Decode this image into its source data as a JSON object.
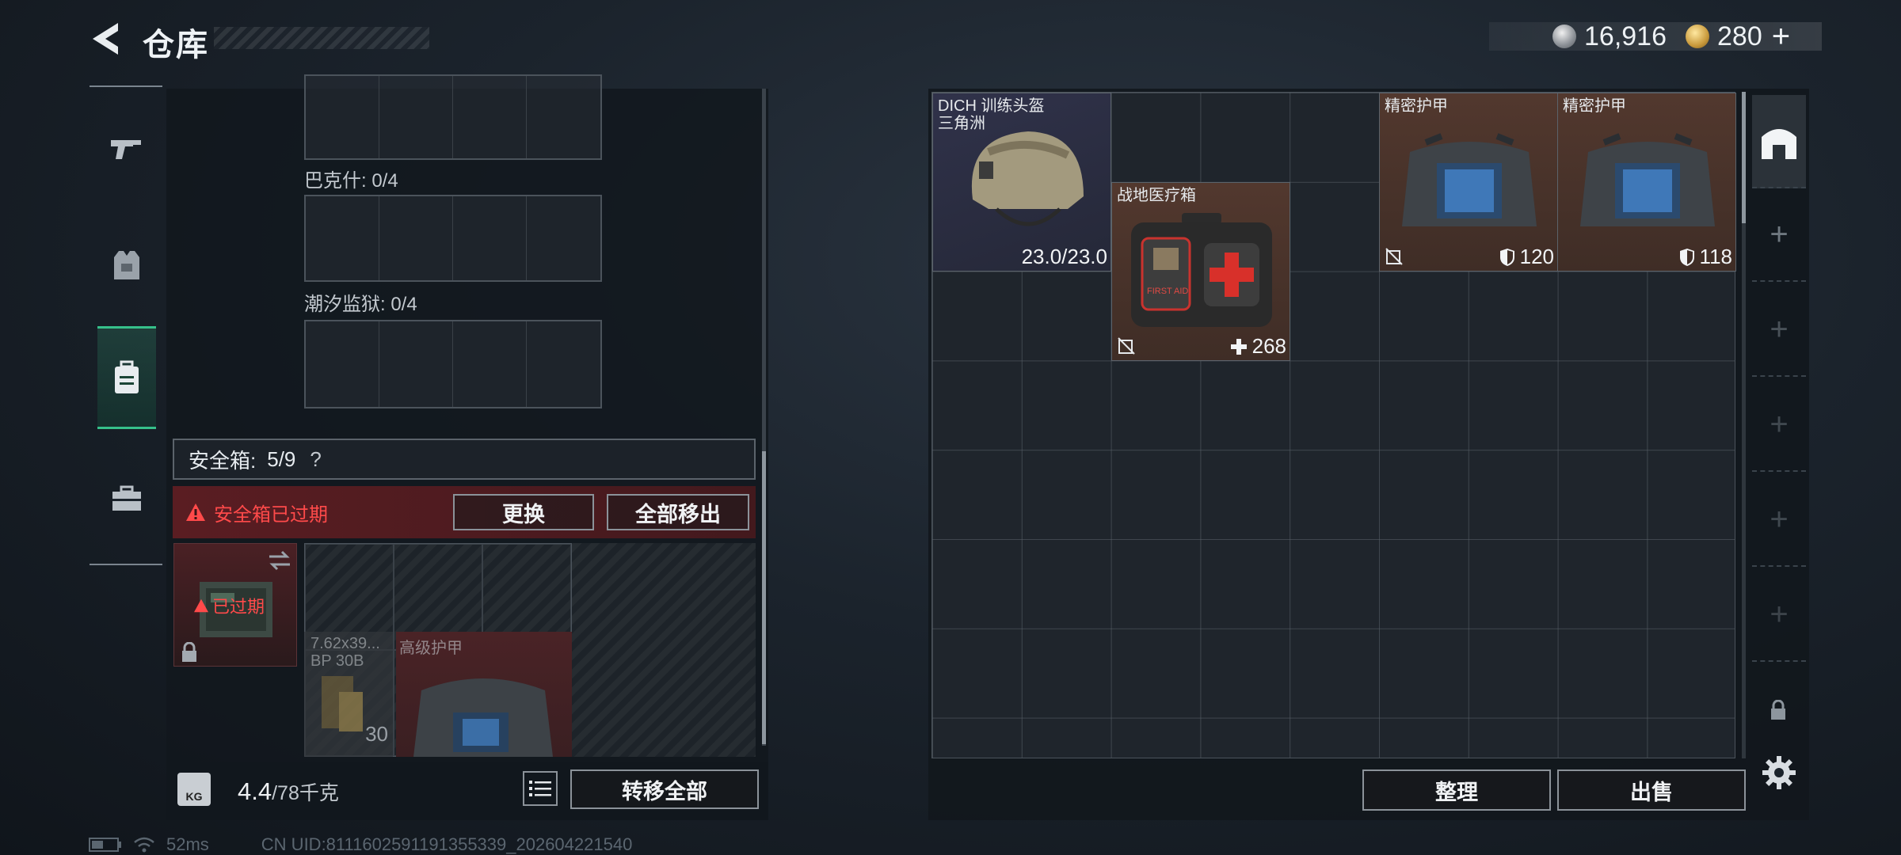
{
  "header": {
    "title": "仓库",
    "currencies": [
      {
        "icon": "silver-coin-icon",
        "value": "16,916"
      },
      {
        "icon": "gold-coin-icon",
        "value": "280"
      }
    ],
    "add_symbol": "+"
  },
  "left_tabs": [
    {
      "icon": "gun-icon",
      "active": false
    },
    {
      "icon": "vest-icon",
      "active": false
    },
    {
      "icon": "backpack-icon",
      "active": true
    },
    {
      "icon": "toolbox-icon",
      "active": false
    }
  ],
  "left_panel": {
    "slot_groups": [
      {
        "label": "巴克什: 0/4"
      },
      {
        "label": "潮汐监狱: 0/4"
      }
    ],
    "safebox": {
      "label": "安全箱:",
      "count": "5/9",
      "help": "?",
      "warning": "安全箱已过期",
      "replace_button": "更换",
      "remove_all_button": "全部移出",
      "expired_tag": "已过期",
      "items": [
        {
          "name": "7.62x39... BP 30B",
          "count": "30"
        },
        {
          "name": "高级护甲"
        }
      ]
    },
    "weight": {
      "current": "4.4",
      "max": "/78千克",
      "icon_text": "KG"
    },
    "transfer_all_button": "转移全部"
  },
  "status": {
    "ping": "52ms",
    "uid": "CN UID:8111602591191355339_202604221540"
  },
  "stash": {
    "items": [
      {
        "name": "DICH 训练头盔",
        "subname": "三角洲",
        "value": "23.0/23.0"
      },
      {
        "name": "战地医疗箱",
        "value": "268",
        "kit_text": "FIRST AID"
      },
      {
        "name": "精密护甲",
        "value": "120"
      },
      {
        "name": "精密护甲",
        "value": "118"
      }
    ],
    "sort_button": "整理",
    "sell_button": "出售"
  },
  "colors": {
    "accent_green": "#36c08a",
    "warning_red": "#ff4a4a"
  }
}
